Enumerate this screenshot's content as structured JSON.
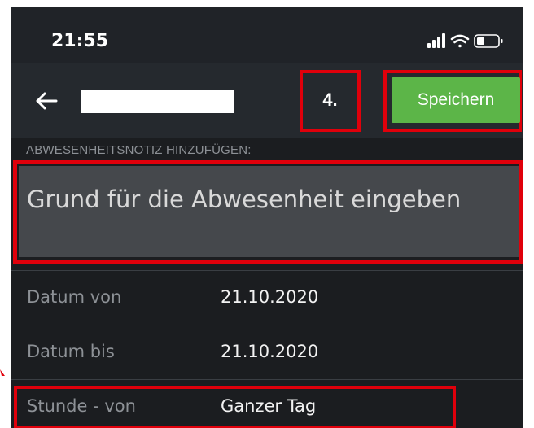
{
  "status_bar": {
    "time": "21:55",
    "icons": [
      "signal-icon",
      "wifi-icon",
      "battery-icon"
    ]
  },
  "app_bar": {
    "back_icon": "arrow-left-icon",
    "title_redacted": true,
    "step_label": "4.",
    "save_label": "Speichern"
  },
  "section": {
    "header": "ABWESENHEITSNOTIZ HINZUFÜGEN:"
  },
  "note": {
    "placeholder": "Grund für die Abwesenheit eingeben"
  },
  "rows": [
    {
      "label": "Datum von",
      "value": "21.10.2020"
    },
    {
      "label": "Datum bis",
      "value": "21.10.2020"
    },
    {
      "label": "Stunde - von",
      "value": "Ganzer Tag"
    }
  ],
  "colors": {
    "background": "#1b1d20",
    "app_bar": "#25292e",
    "save_button": "#5cb548",
    "input_field": "#45484c",
    "highlight": "#e0000b",
    "label_text": "#8d9196",
    "value_text": "#f2f2f2"
  }
}
